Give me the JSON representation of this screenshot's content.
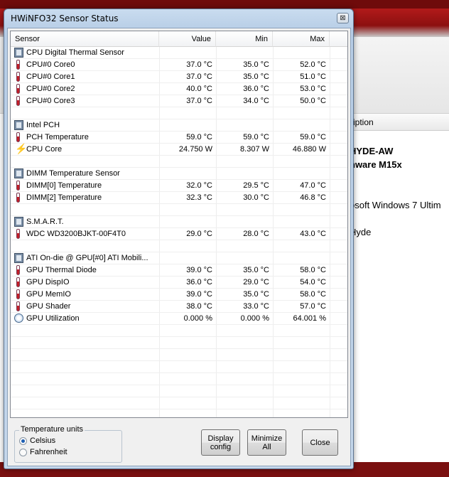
{
  "background": {
    "col_header": "ription",
    "lines": [
      {
        "text": "HYDE-AW",
        "bold": true
      },
      {
        "text": "nware M15x",
        "bold": true
      },
      {
        "text": "osoft Windows 7 Ultim",
        "bold": false
      },
      {
        "text": "Hyde",
        "bold": false
      }
    ]
  },
  "window": {
    "title": "HWiNFO32 Sensor Status",
    "close_glyph": "⊠"
  },
  "columns": {
    "sensor": "Sensor",
    "value": "Value",
    "min": "Min",
    "max": "Max"
  },
  "rows": [
    {
      "icon": "group",
      "name": "CPU Digital Thermal Sensor",
      "value": "",
      "min": "",
      "max": ""
    },
    {
      "icon": "therm",
      "name": "CPU#0 Core0",
      "value": "37.0 °C",
      "min": "35.0 °C",
      "max": "52.0 °C"
    },
    {
      "icon": "therm",
      "name": "CPU#0 Core1",
      "value": "37.0 °C",
      "min": "35.0 °C",
      "max": "51.0 °C"
    },
    {
      "icon": "therm",
      "name": "CPU#0 Core2",
      "value": "40.0 °C",
      "min": "36.0 °C",
      "max": "53.0 °C"
    },
    {
      "icon": "therm",
      "name": "CPU#0 Core3",
      "value": "37.0 °C",
      "min": "34.0 °C",
      "max": "50.0 °C"
    },
    {
      "icon": "",
      "name": "",
      "value": "",
      "min": "",
      "max": ""
    },
    {
      "icon": "group",
      "name": "Intel PCH",
      "value": "",
      "min": "",
      "max": ""
    },
    {
      "icon": "therm",
      "name": "PCH Temperature",
      "value": "59.0 °C",
      "min": "59.0 °C",
      "max": "59.0 °C"
    },
    {
      "icon": "bolt",
      "name": "CPU Core",
      "value": "24.750 W",
      "min": "8.307 W",
      "max": "46.880 W"
    },
    {
      "icon": "",
      "name": "",
      "value": "",
      "min": "",
      "max": ""
    },
    {
      "icon": "group",
      "name": "DIMM Temperature Sensor",
      "value": "",
      "min": "",
      "max": ""
    },
    {
      "icon": "therm",
      "name": "DIMM[0] Temperature",
      "value": "32.0 °C",
      "min": "29.5 °C",
      "max": "47.0 °C"
    },
    {
      "icon": "therm",
      "name": "DIMM[2] Temperature",
      "value": "32.3 °C",
      "min": "30.0 °C",
      "max": "46.8 °C"
    },
    {
      "icon": "",
      "name": "",
      "value": "",
      "min": "",
      "max": ""
    },
    {
      "icon": "group",
      "name": "S.M.A.R.T.",
      "value": "",
      "min": "",
      "max": ""
    },
    {
      "icon": "therm",
      "name": "WDC WD3200BJKT-00F4T0",
      "value": "29.0 °C",
      "min": "28.0 °C",
      "max": "43.0 °C"
    },
    {
      "icon": "",
      "name": "",
      "value": "",
      "min": "",
      "max": ""
    },
    {
      "icon": "group",
      "name": "ATI On-die @ GPU[#0] ATI Mobili...",
      "value": "",
      "min": "",
      "max": ""
    },
    {
      "icon": "therm",
      "name": "GPU Thermal Diode",
      "value": "39.0 °C",
      "min": "35.0 °C",
      "max": "58.0 °C"
    },
    {
      "icon": "therm",
      "name": "GPU DispIO",
      "value": "36.0 °C",
      "min": "29.0 °C",
      "max": "54.0 °C"
    },
    {
      "icon": "therm",
      "name": "GPU MemIO",
      "value": "39.0 °C",
      "min": "35.0 °C",
      "max": "58.0 °C"
    },
    {
      "icon": "therm",
      "name": "GPU Shader",
      "value": "38.0 °C",
      "min": "33.0 °C",
      "max": "57.0 °C"
    },
    {
      "icon": "gauge",
      "name": "GPU Utilization",
      "value": "0.000 %",
      "min": "0.000 %",
      "max": "64.001 %"
    }
  ],
  "units": {
    "legend": "Temperature units",
    "celsius": "Celsius",
    "fahrenheit": "Fahrenheit",
    "selected": "Celsius"
  },
  "buttons": {
    "display_config": "Display\nconfig",
    "minimize_all": "Minimize\nAll",
    "close": "Close"
  }
}
